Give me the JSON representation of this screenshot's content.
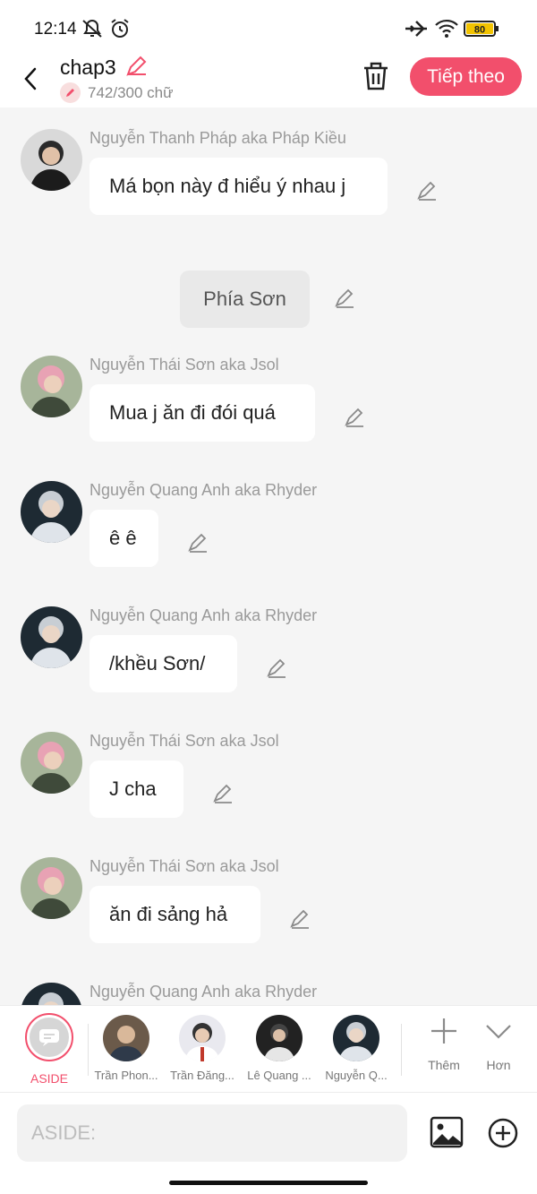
{
  "status_bar": {
    "time": "12:14",
    "battery": "80"
  },
  "header": {
    "title": "chap3",
    "word_count": "742/300 chữ",
    "next_label": "Tiếp theo"
  },
  "messages": [
    {
      "sender": "Nguyễn Thanh Pháp aka Pháp Kiều",
      "text": "Má bọn này đ hiểu ý nhau j"
    },
    {
      "scene": "Phía Sơn"
    },
    {
      "sender": "Nguyễn Thái Sơn aka Jsol",
      "text": "Mua j ăn đi đói quá"
    },
    {
      "sender": "Nguyễn Quang Anh aka Rhyder",
      "text": "ê ê"
    },
    {
      "sender": "Nguyễn Quang Anh aka Rhyder",
      "text": "/khều Sơn/"
    },
    {
      "sender": "Nguyễn Thái Sơn aka Jsol",
      "text": "J cha"
    },
    {
      "sender": "Nguyễn Thái Sơn aka Jsol",
      "text": "ăn đi sảng hả"
    },
    {
      "sender": "Nguyễn Quang Anh aka Rhyder"
    }
  ],
  "characters": [
    {
      "name": "ASIDE"
    },
    {
      "name": "Trần Phon..."
    },
    {
      "name": "Trần Đăng..."
    },
    {
      "name": "Lê Quang ..."
    },
    {
      "name": "Nguyễn Q..."
    }
  ],
  "actions": {
    "add": "Thêm",
    "more": "Hơn"
  },
  "input": {
    "placeholder": "ASIDE:"
  },
  "colors": {
    "accent": "#f24f6c"
  }
}
